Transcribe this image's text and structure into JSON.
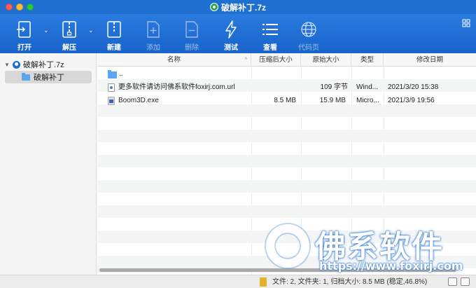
{
  "window": {
    "title": "破解补丁.7z"
  },
  "toolbar": {
    "items": [
      {
        "label": "打开",
        "icon": "open-icon",
        "enabled": true
      },
      {
        "label": "解压",
        "icon": "extract-icon",
        "enabled": true
      },
      {
        "label": "新建",
        "icon": "new-archive-icon",
        "enabled": true
      },
      {
        "label": "添加",
        "icon": "add-icon",
        "enabled": false
      },
      {
        "label": "删除",
        "icon": "delete-icon",
        "enabled": false
      },
      {
        "label": "测试",
        "icon": "test-icon",
        "enabled": true
      },
      {
        "label": "查看",
        "icon": "view-icon",
        "enabled": true
      },
      {
        "label": "代码页",
        "icon": "globe-icon",
        "enabled": false
      }
    ]
  },
  "sidebar": {
    "root": "破解补丁.7z",
    "child": "破解补丁"
  },
  "columns": {
    "name": "名称",
    "compressed": "压缩后大小",
    "original": "原始大小",
    "type": "类型",
    "modified": "修改日期"
  },
  "files": [
    {
      "name": "..",
      "compressed": "",
      "original": "",
      "type": "",
      "modified": "",
      "icon": "folder-icon"
    },
    {
      "name": "更多软件请访问佛系软件foxirj.com.url",
      "compressed": "",
      "original": "109 字节",
      "type": "Wind...",
      "modified": "2021/3/20 15:38",
      "icon": "url-file-icon"
    },
    {
      "name": "Boom3D.exe",
      "compressed": "8.5 MB",
      "original": "15.9 MB",
      "type": "Micro...",
      "modified": "2021/3/9 19:56",
      "icon": "exe-file-icon"
    }
  ],
  "status": {
    "text": "文件: 2, 文件夹: 1, 归档大小: 8.5 MB (稳定,46.8%)"
  },
  "watermark": {
    "title": "佛系软件",
    "url": "https://www.foxirj.com"
  },
  "colors": {
    "toolbar": "#1e6fd0",
    "selection": "#d8d8d8",
    "folder": "#5aa7f0"
  }
}
